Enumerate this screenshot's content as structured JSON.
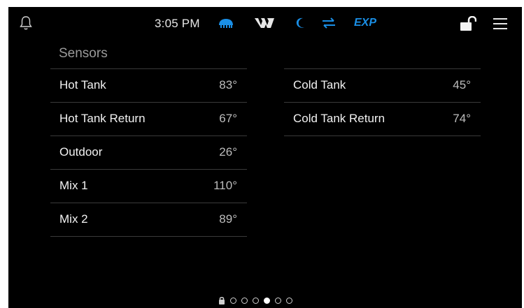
{
  "status_bar": {
    "time": "3:05 PM",
    "icons": [
      "bell-icon",
      "flame-icon",
      "brand-w-icon",
      "moon-icon",
      "swap-arrows-icon",
      "unlock-icon",
      "menu-icon"
    ],
    "mode_label": "EXP",
    "accent_color": "#1a8fe6"
  },
  "page": {
    "heading": "Sensors"
  },
  "sensors": {
    "left": [
      {
        "label": "Hot Tank",
        "value": "83°"
      },
      {
        "label": "Hot Tank Return",
        "value": "67°"
      },
      {
        "label": "Outdoor",
        "value": "26°"
      },
      {
        "label": "Mix 1",
        "value": "110°"
      },
      {
        "label": "Mix 2",
        "value": "89°"
      }
    ],
    "right": [
      {
        "label": "Cold Tank",
        "value": "45°"
      },
      {
        "label": "Cold Tank Return",
        "value": "74°"
      }
    ]
  },
  "pagination": {
    "page_count": 6,
    "active_page": 4
  }
}
